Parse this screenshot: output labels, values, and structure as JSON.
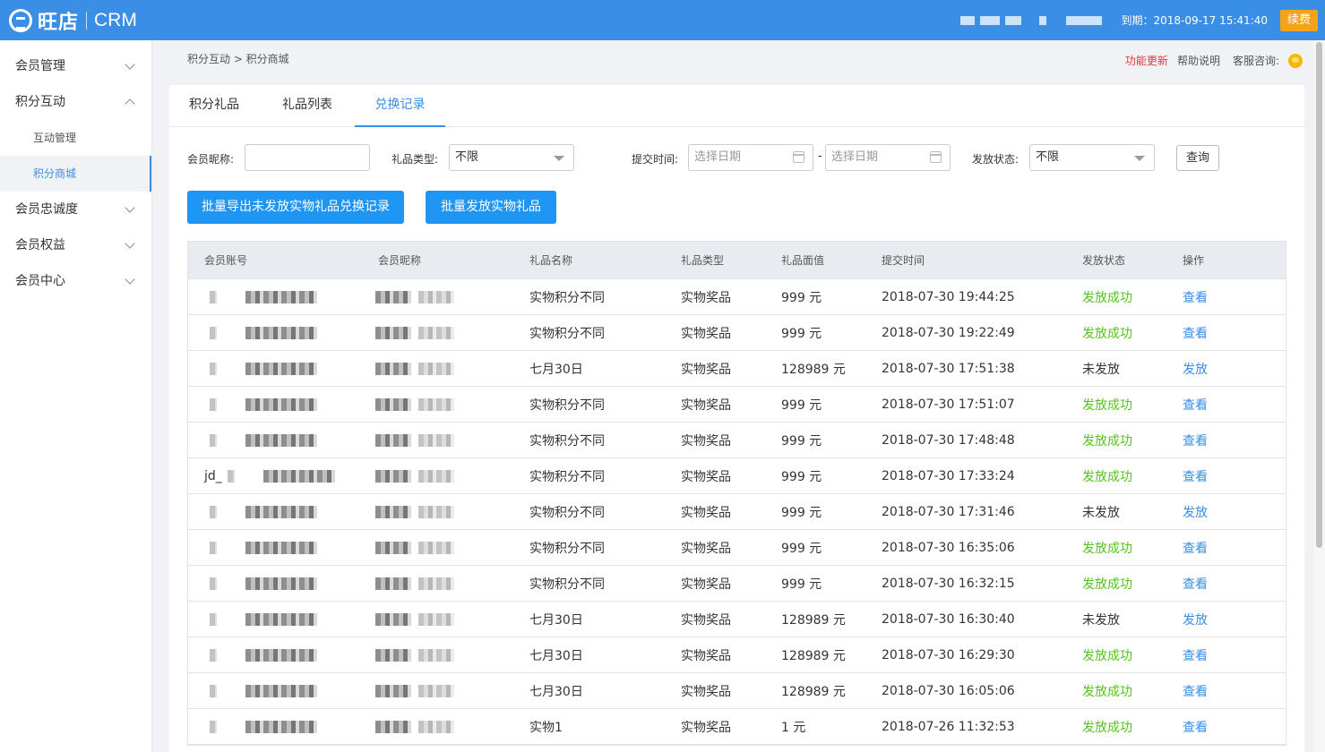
{
  "app": {
    "logo_name": "旺店",
    "product": "CRM"
  },
  "topbar": {
    "expire_text": "到期：2018-09-17 15:41:40",
    "renew_label": "续费"
  },
  "sidebar": {
    "groups": [
      {
        "label": "会员管理"
      },
      {
        "label": "积分互动",
        "subitems": [
          "互动管理",
          "积分商城"
        ],
        "active_sub": "积分商城"
      },
      {
        "label": "会员忠诚度"
      },
      {
        "label": "会员权益"
      },
      {
        "label": "会员中心"
      }
    ]
  },
  "breadcrumb": "积分互动 > 积分商城",
  "header_links": {
    "update": "功能更新",
    "help": "帮助说明",
    "support": "客服咨询:"
  },
  "tabs": [
    "积分礼品",
    "礼品列表",
    "兑换记录"
  ],
  "active_tab": "兑换记录",
  "filters": {
    "nickname_label": "会员昵称:",
    "nickname_value": "",
    "gift_type_label": "礼品类型:",
    "gift_type_value": "不限",
    "submit_time_label": "提交时间:",
    "date_placeholder_start": "选择日期",
    "date_placeholder_end": "选择日期",
    "date_sep": "-",
    "status_label": "发放状态:",
    "status_value": "不限",
    "query_label": "查询"
  },
  "actions": {
    "export_label": "批量导出未发放实物礼品兑换记录",
    "issue_label": "批量发放实物礼品"
  },
  "table": {
    "columns": [
      "会员账号",
      "会员昵称",
      "礼品名称",
      "礼品类型",
      "礼品面值",
      "提交时间",
      "发放状态",
      "操作"
    ],
    "rows": [
      {
        "account": "",
        "nickname": "",
        "gift_name": "实物积分不同",
        "gift_type": "实物奖品",
        "value": "999 元",
        "time": "2018-07-30 19:44:25",
        "status": "发放成功",
        "action": "查看"
      },
      {
        "account": "",
        "nickname": "",
        "gift_name": "实物积分不同",
        "gift_type": "实物奖品",
        "value": "999 元",
        "time": "2018-07-30 19:22:49",
        "status": "发放成功",
        "action": "查看"
      },
      {
        "account": "",
        "nickname": "",
        "gift_name": "七月30日",
        "gift_type": "实物奖品",
        "value": "128989 元",
        "time": "2018-07-30 17:51:38",
        "status": "未发放",
        "action": "发放"
      },
      {
        "account": "",
        "nickname": "",
        "gift_name": "实物积分不同",
        "gift_type": "实物奖品",
        "value": "999 元",
        "time": "2018-07-30 17:51:07",
        "status": "发放成功",
        "action": "查看"
      },
      {
        "account": "",
        "nickname": "",
        "gift_name": "实物积分不同",
        "gift_type": "实物奖品",
        "value": "999 元",
        "time": "2018-07-30 17:48:48",
        "status": "发放成功",
        "action": "查看"
      },
      {
        "account": "jd_",
        "nickname": "",
        "gift_name": "实物积分不同",
        "gift_type": "实物奖品",
        "value": "999 元",
        "time": "2018-07-30 17:33:24",
        "status": "发放成功",
        "action": "查看"
      },
      {
        "account": "",
        "nickname": "",
        "gift_name": "实物积分不同",
        "gift_type": "实物奖品",
        "value": "999 元",
        "time": "2018-07-30 17:31:46",
        "status": "未发放",
        "action": "发放"
      },
      {
        "account": "",
        "nickname": "",
        "gift_name": "实物积分不同",
        "gift_type": "实物奖品",
        "value": "999 元",
        "time": "2018-07-30 16:35:06",
        "status": "发放成功",
        "action": "查看"
      },
      {
        "account": "",
        "nickname": "",
        "gift_name": "实物积分不同",
        "gift_type": "实物奖品",
        "value": "999 元",
        "time": "2018-07-30 16:32:15",
        "status": "发放成功",
        "action": "查看"
      },
      {
        "account": "",
        "nickname": "",
        "gift_name": "七月30日",
        "gift_type": "实物奖品",
        "value": "128989 元",
        "time": "2018-07-30 16:30:40",
        "status": "未发放",
        "action": "发放"
      },
      {
        "account": "",
        "nickname": "",
        "gift_name": "七月30日",
        "gift_type": "实物奖品",
        "value": "128989 元",
        "time": "2018-07-30 16:29:30",
        "status": "发放成功",
        "action": "查看"
      },
      {
        "account": "",
        "nickname": "",
        "gift_name": "七月30日",
        "gift_type": "实物奖品",
        "value": "128989 元",
        "time": "2018-07-30 16:05:06",
        "status": "发放成功",
        "action": "查看"
      },
      {
        "account": "",
        "nickname": "",
        "gift_name": "实物1",
        "gift_type": "实物奖品",
        "value": "1 元",
        "time": "2018-07-26 11:32:53",
        "status": "发放成功",
        "action": "查看"
      }
    ]
  },
  "colors": {
    "brand": "#3a8ee6",
    "success": "#52c41a",
    "primary_button": "#1f95f4",
    "renew": "#f7a21b",
    "update_link": "#e4393c"
  },
  "icons": {
    "logo": "wangdian-logo-icon",
    "chat": "chat-bubble-icon",
    "calendar": "calendar-icon",
    "chevron": "chevron-icon",
    "caret": "caret-down-icon"
  }
}
